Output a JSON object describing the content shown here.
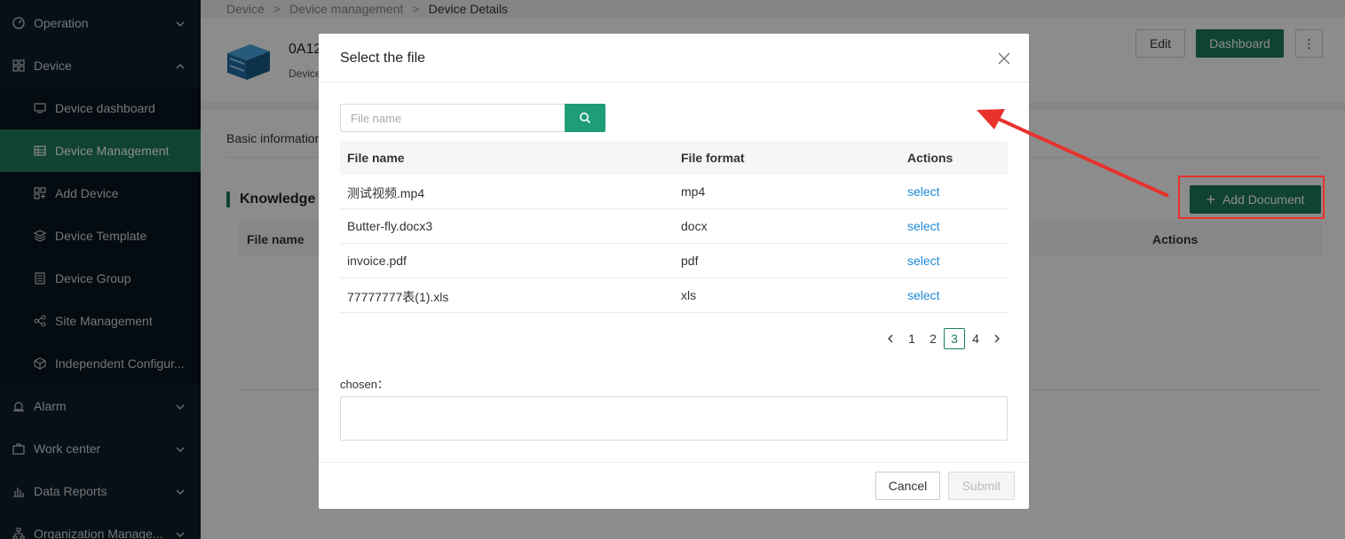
{
  "sidebar": {
    "items": [
      {
        "label": "Operation",
        "icon": "dashboard-icon",
        "level": "top",
        "expanded": false
      },
      {
        "label": "Device",
        "icon": "grid-icon",
        "level": "top",
        "expanded": true
      },
      {
        "label": "Device dashboard",
        "icon": "monitor-icon",
        "level": "sub"
      },
      {
        "label": "Device Management",
        "icon": "table-icon",
        "level": "sub",
        "active": true
      },
      {
        "label": "Add Device",
        "icon": "add-grid-icon",
        "level": "sub"
      },
      {
        "label": "Device Template",
        "icon": "template-icon",
        "level": "sub"
      },
      {
        "label": "Device Group",
        "icon": "group-icon",
        "level": "sub"
      },
      {
        "label": "Site Management",
        "icon": "site-icon",
        "level": "sub"
      },
      {
        "label": "Independent Configur...",
        "icon": "cube-icon",
        "level": "sub"
      },
      {
        "label": "Alarm",
        "icon": "alarm-icon",
        "level": "top",
        "expanded": false
      },
      {
        "label": "Work center",
        "icon": "briefcase-icon",
        "level": "top",
        "expanded": false
      },
      {
        "label": "Data Reports",
        "icon": "bar-chart-icon",
        "level": "top",
        "expanded": false
      },
      {
        "label": "Organization Manage...",
        "icon": "org-icon",
        "level": "top",
        "expanded": false
      }
    ]
  },
  "breadcrumb": [
    "Device",
    "Device management",
    "Device Details"
  ],
  "device": {
    "name": "0A12",
    "sub": "Device"
  },
  "header_buttons": {
    "edit": "Edit",
    "dashboard": "Dashboard",
    "more": "⋮"
  },
  "tabs": {
    "basic": "Basic information"
  },
  "knowledge": {
    "title": "Knowledge",
    "col_file": "File name",
    "col_actions": "Actions",
    "add_button": "Add Document",
    "add_icon": "+"
  },
  "modal": {
    "title": "Select the file",
    "search_placeholder": "File name",
    "columns": {
      "name": "File name",
      "format": "File format",
      "actions": "Actions"
    },
    "rows": [
      {
        "name": "测试视频.mp4",
        "format": "mp4",
        "action": "select"
      },
      {
        "name": "Butter-fly.docx3",
        "format": "docx",
        "action": "select"
      },
      {
        "name": "invoice.pdf",
        "format": "pdf",
        "action": "select"
      },
      {
        "name": "77777777表(1).xls",
        "format": "xls",
        "action": "select"
      }
    ],
    "pagination": {
      "pages": [
        "1",
        "2",
        "3",
        "4"
      ],
      "current": "3"
    },
    "chosen_label": "chosen：",
    "cancel": "Cancel",
    "submit": "Submit"
  },
  "colors": {
    "accent": "#1e7a5c",
    "link": "#1d8ad8",
    "sidebar_bg": "#0d1e2b",
    "annotation": "#e8322c"
  }
}
